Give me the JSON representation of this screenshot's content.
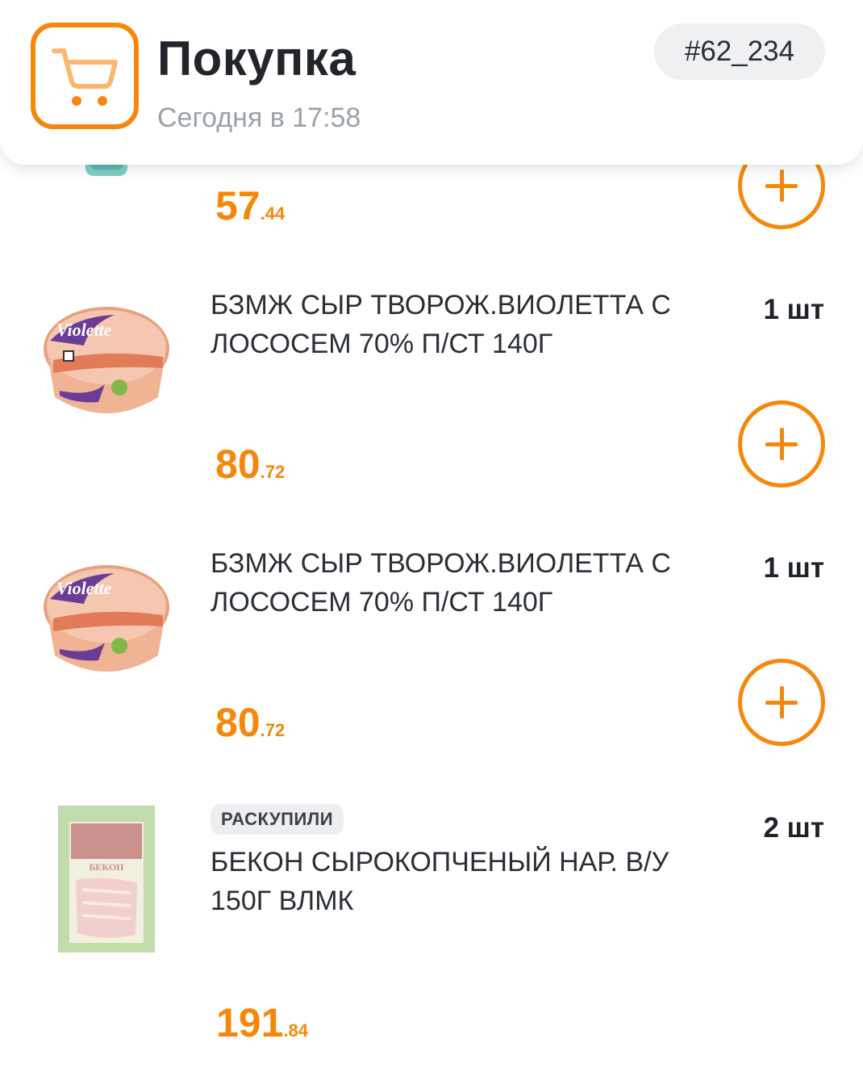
{
  "header": {
    "title": "Покупка",
    "subtitle": "Сегодня в 17:58",
    "order_number": "#62_234",
    "icon": "shopping-cart-icon"
  },
  "colors": {
    "accent": "#f7870a",
    "text": "#1e2329",
    "muted": "#9aa1a8",
    "badge_bg": "#eef0f2"
  },
  "items": [
    {
      "price_rub": "57",
      "price_kop": ".44",
      "add_icon": "plus-icon"
    },
    {
      "name": "БЗМЖ СЫР ТВОРОЖ.ВИОЛЕТТА С ЛОСОСЕМ 70% П/СТ 140Г",
      "qty": "1 шт",
      "price_rub": "80",
      "price_kop": ".72",
      "image_brand": "Violette",
      "add_icon": "plus-icon"
    },
    {
      "name": "БЗМЖ СЫР ТВОРОЖ.ВИОЛЕТТА С ЛОСОСЕМ 70% П/СТ 140Г",
      "qty": "1 шт",
      "price_rub": "80",
      "price_kop": ".72",
      "image_brand": "Violette",
      "add_icon": "plus-icon"
    },
    {
      "badge": "РАСКУПИЛИ",
      "name": "БЕКОН СЫРОКОПЧЕНЫЙ НАР. В/У 150Г ВЛМК",
      "qty": "2 шт",
      "price_rub": "191",
      "price_kop": ".84",
      "image_label": "БЕКОН"
    }
  ]
}
